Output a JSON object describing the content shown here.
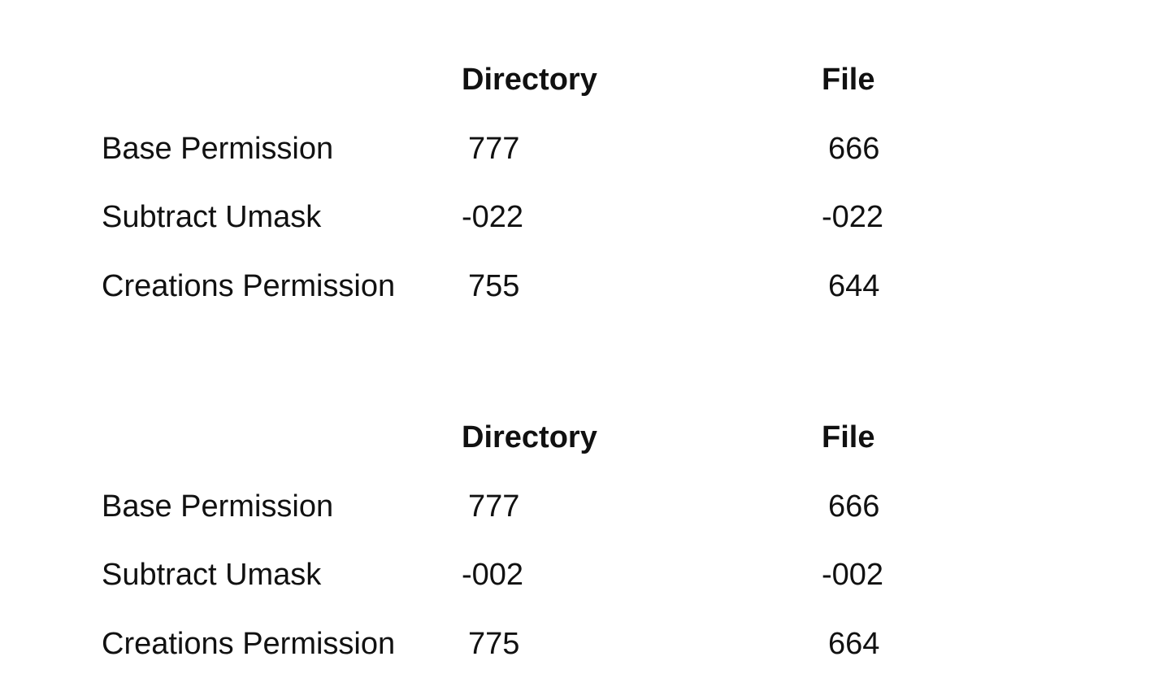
{
  "tables": [
    {
      "headers": {
        "directory": "Directory",
        "file": "File"
      },
      "rows": [
        {
          "label": "Base Permission",
          "directory": "777",
          "file": "666"
        },
        {
          "label": "Subtract Umask",
          "directory": "-022",
          "file": "-022"
        },
        {
          "label": "Creations Permission",
          "directory": "755",
          "file": "644"
        }
      ]
    },
    {
      "headers": {
        "directory": "Directory",
        "file": "File"
      },
      "rows": [
        {
          "label": "Base Permission",
          "directory": "777",
          "file": "666"
        },
        {
          "label": "Subtract Umask",
          "directory": "-002",
          "file": "-002"
        },
        {
          "label": "Creations Permission",
          "directory": "775",
          "file": "664"
        }
      ]
    }
  ]
}
